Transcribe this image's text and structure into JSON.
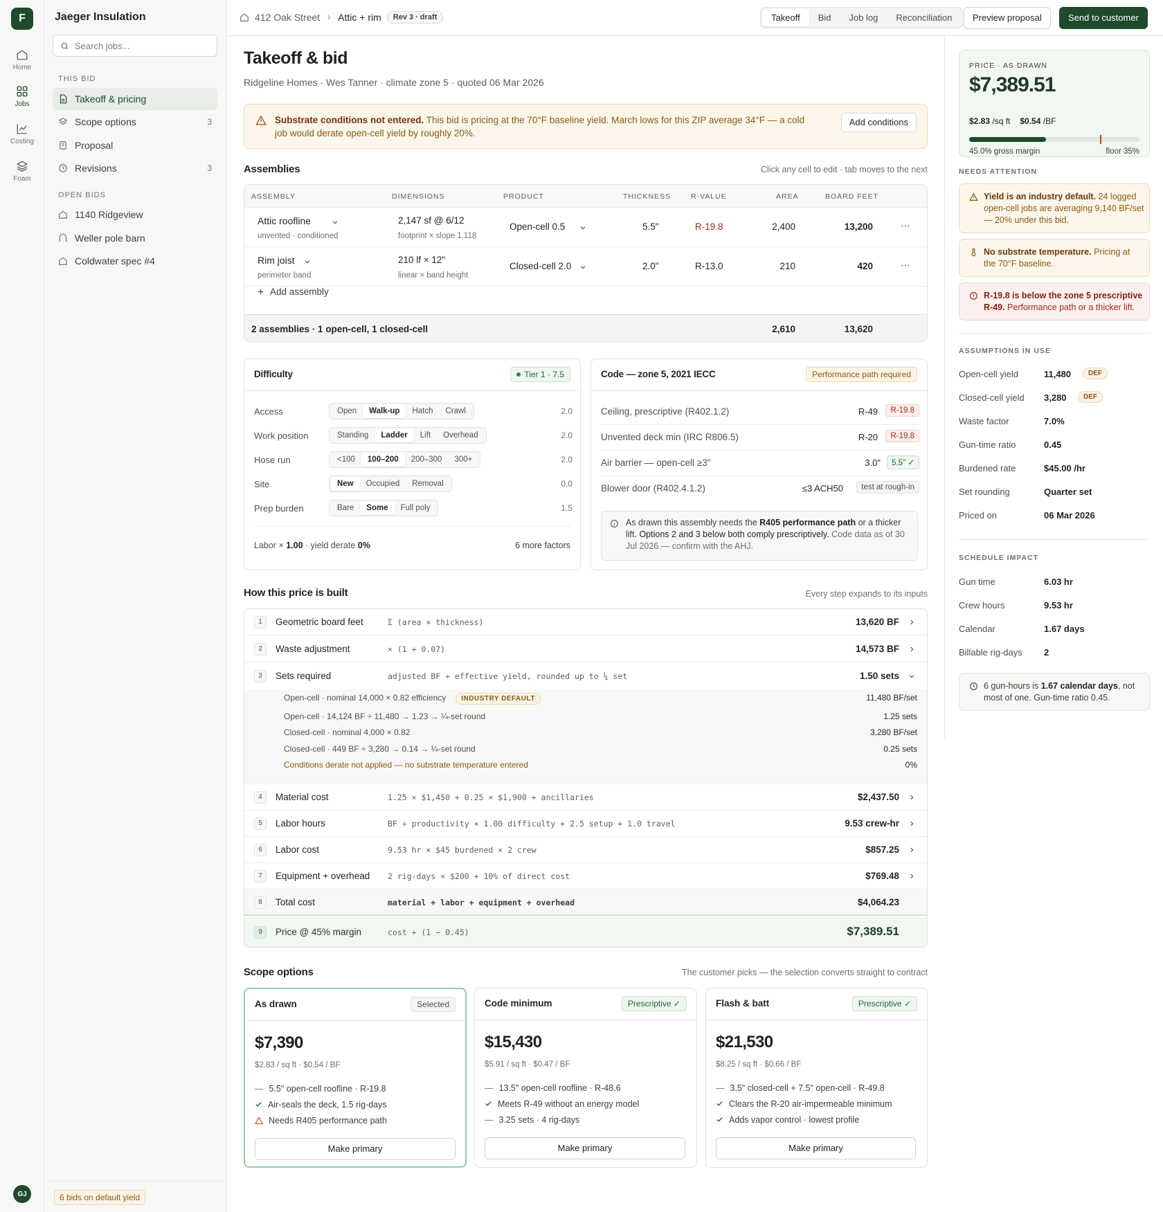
{
  "rail": {
    "logo": "F",
    "items": [
      {
        "label": "Home",
        "icon": "home-icon"
      },
      {
        "label": "Jobs",
        "icon": "jobs-icon"
      },
      {
        "label": "Costing",
        "icon": "chart-icon"
      },
      {
        "label": "Foam",
        "icon": "layers-icon"
      }
    ],
    "user_initials": "GJ"
  },
  "sidebar": {
    "org": "Jaeger Insulation",
    "search_placeholder": "Search jobs...",
    "section_this_bid": "THIS BID",
    "this_bid_items": [
      {
        "label": "Takeoff & pricing",
        "count": ""
      },
      {
        "label": "Scope options",
        "count": "3"
      },
      {
        "label": "Proposal",
        "count": ""
      },
      {
        "label": "Revisions",
        "count": "3"
      }
    ],
    "section_open_bids": "OPEN BIDS",
    "open_bids": [
      "1140 Ridgeview",
      "Weller pole barn",
      "Coldwater spec #4"
    ],
    "footer_chip": "6 bids on default yield"
  },
  "topbar": {
    "breadcrumb": [
      "412 Oak Street",
      "Attic + rim"
    ],
    "rev_badge": "Rev 3 · draft",
    "tabs": [
      "Takeoff",
      "Bid",
      "Job log",
      "Reconciliation"
    ],
    "active_tab": "Takeoff",
    "preview_label": "Preview proposal",
    "send_label": "Send to customer"
  },
  "page": {
    "title": "Takeoff & bid",
    "subtitle": "Ridgeline Homes · Wes Tanner · climate zone 5 · quoted 06 Mar 2026"
  },
  "alert": {
    "bold": "Substrate conditions not entered.",
    "text": " This bid is pricing at the 70°F baseline yield. March lows for this ZIP average 34°F — a cold job would derate open-cell yield by roughly 20%.",
    "button": "Add conditions"
  },
  "assemblies": {
    "title": "Assemblies",
    "hint": "Click any cell to edit · tab moves to the next",
    "columns": [
      "ASSEMBLY",
      "DIMENSIONS",
      "PRODUCT",
      "THICKNESS",
      "R-VALUE",
      "AREA",
      "BOARD FEET"
    ],
    "rows": [
      {
        "name": "Attic roofline",
        "sub": "unvented · conditioned",
        "dims": "2,147 sf @ 6/12",
        "dims_sub": "footprint × slope 1.118",
        "product": "Open-cell 0.5",
        "thickness": "5.5\"",
        "rvalue": "R-19.8",
        "area": "2,400",
        "bf": "13,200"
      },
      {
        "name": "Rim joist",
        "sub": "perimeter band",
        "dims": "210 lf × 12\"",
        "dims_sub": "linear × band height",
        "product": "Closed-cell 2.0",
        "thickness": "2.0\"",
        "rvalue": "R-13.0",
        "area": "210",
        "bf": "420"
      }
    ],
    "add_label": "Add assembly",
    "footer_summary": "2 assemblies · 1 open-cell, 1 closed-cell",
    "footer_area": "2,610",
    "footer_bf": "13,620"
  },
  "difficulty": {
    "title": "Difficulty",
    "tier": "Tier 1 · 7.5",
    "rows": [
      {
        "label": "Access",
        "options": [
          "Open",
          "Walk-up",
          "Hatch",
          "Crawl"
        ],
        "selected": "Walk-up",
        "value": "2.0"
      },
      {
        "label": "Work position",
        "options": [
          "Standing",
          "Ladder",
          "Lift",
          "Overhead"
        ],
        "selected": "Ladder",
        "value": "2.0"
      },
      {
        "label": "Hose run",
        "options": [
          "<100",
          "100–200",
          "200–300",
          "300+"
        ],
        "selected": "100–200",
        "value": "2.0"
      },
      {
        "label": "Site",
        "options": [
          "New",
          "Occupied",
          "Removal"
        ],
        "selected": "New",
        "value": "0.0"
      },
      {
        "label": "Prep burden",
        "options": [
          "Bare",
          "Some",
          "Full poly"
        ],
        "selected": "Some",
        "value": "1.5"
      }
    ],
    "labor_prefix": "Labor × ",
    "labor_value": "1.00",
    "yield_prefix": " · yield derate ",
    "yield_value": "0%",
    "more_factors": "6 more factors"
  },
  "code": {
    "title": "Code — zone 5, 2021 IECC",
    "badge": "Performance path required",
    "rows": [
      {
        "label": "Ceiling, prescriptive (R402.1.2)",
        "req": "R-49",
        "tag": "R-19.8",
        "tag_type": "red"
      },
      {
        "label": "Unvented deck min (IRC R806.5)",
        "req": "R-20",
        "tag": "R-19.8",
        "tag_type": "red"
      },
      {
        "label": "Air barrier — open-cell ≥3\"",
        "req": "3.0\"",
        "tag": "5.5\" ✓",
        "tag_type": "green"
      },
      {
        "label": "Blower door (R402.4.1.2)",
        "req": "≤3 ACH50",
        "tag": "test at rough-in",
        "tag_type": "gray"
      }
    ],
    "note_pre": "As drawn this assembly needs the ",
    "note_bold": "R405 performance path",
    "note_mid": " or a thicker lift. ",
    "note_dark": "Options 2 and 3 below both comply prescriptively.",
    "note_post": " Code data as of 30 Jul 2026 — confirm with the AHJ."
  },
  "price_build": {
    "title": "How this price is built",
    "hint": "Every step expands to its inputs",
    "steps": [
      {
        "n": "1",
        "name": "Geometric board feet",
        "formula": "Σ (area × thickness)",
        "value": "13,620 BF"
      },
      {
        "n": "2",
        "name": "Waste adjustment",
        "formula": "× (1 + 0.07)",
        "value": "14,573 BF"
      },
      {
        "n": "3",
        "name": "Sets required",
        "formula": "adjusted BF ÷ effective yield, rounded up to ¼ set",
        "value": "1.50 sets"
      },
      {
        "n": "4",
        "name": "Material cost",
        "formula": "1.25 × $1,450 + 0.25 × $1,900 + ancillaries",
        "value": "$2,437.50"
      },
      {
        "n": "5",
        "name": "Labor hours",
        "formula": "BF ÷ productivity × 1.00 difficulty + 2.5 setup + 1.0 travel",
        "value": "9.53 crew-hr"
      },
      {
        "n": "6",
        "name": "Labor cost",
        "formula": "9.53 hr × $45 burdened × 2 crew",
        "value": "$857.25"
      },
      {
        "n": "7",
        "name": "Equipment + overhead",
        "formula": "2 rig-days × $200 + 10% of direct cost",
        "value": "$769.48"
      },
      {
        "n": "8",
        "name": "Total cost",
        "formula": "material + labor + equipment + overhead",
        "value": "$4,064.23"
      },
      {
        "n": "9",
        "name": "Price @ 45% margin",
        "formula": "cost ÷ (1 − 0.45)",
        "value": "$7,389.51"
      }
    ],
    "sub_rows": [
      {
        "label": "Open-cell · nominal 14,000 × 0.82 efficiency",
        "badge": "INDUSTRY DEFAULT",
        "value": "11,480 BF/set"
      },
      {
        "label": "Open-cell · 14,124 BF ÷ 11,480 → 1.23 → ¼-set round",
        "value": "1.25 sets"
      },
      {
        "label": "Closed-cell · nominal 4,000 × 0.82",
        "value": "3,280 BF/set"
      },
      {
        "label": "Closed-cell · 449 BF ÷ 3,280 → 0.14 → ¼-set round",
        "value": "0.25 sets"
      },
      {
        "label": "Conditions derate not applied — no substrate temperature entered",
        "value": "0%"
      }
    ]
  },
  "scope": {
    "title": "Scope options",
    "hint": "The customer picks — the selection converts straight to contract",
    "options": [
      {
        "name": "As drawn",
        "badge": "Selected",
        "price": "$7,390",
        "unit": "$2.83 / sq ft · $0.54 / BF",
        "bullets": [
          {
            "icon": "dash-icon",
            "text": "5.5\" open-cell roofline · R-19.8"
          },
          {
            "icon": "check-icon",
            "text": "Air-seals the deck, 1.5 rig-days"
          },
          {
            "icon": "warning-icon",
            "text": "Needs R405 performance path"
          }
        ],
        "button": "Make primary"
      },
      {
        "name": "Code minimum",
        "badge": "Prescriptive ✓",
        "price": "$15,430",
        "unit": "$5.91 / sq ft · $0.47 / BF",
        "bullets": [
          {
            "icon": "dash-icon",
            "text": "13.5\" open-cell roofline · R-48.6"
          },
          {
            "icon": "check-icon",
            "text": "Meets R-49 without an energy model"
          },
          {
            "icon": "dash-icon",
            "text": "3.25 sets · 4 rig-days"
          }
        ],
        "button": "Make primary"
      },
      {
        "name": "Flash & batt",
        "badge": "Prescriptive ✓",
        "price": "$21,530",
        "unit": "$8.25 / sq ft · $0.66 / BF",
        "bullets": [
          {
            "icon": "dash-icon",
            "text": "3.5\" closed-cell + 7.5\" open-cell · R-49.8"
          },
          {
            "icon": "check-icon",
            "text": "Clears the R-20 air-impermeable minimum"
          },
          {
            "icon": "check-icon",
            "text": "Adds vapor control · lowest profile"
          }
        ],
        "button": "Make primary"
      }
    ]
  },
  "right_panel": {
    "price_label": "PRICE · AS DRAWN",
    "price": "$7,389.51",
    "per_sqft": "$2.83",
    "per_sqft_unit": " /sq ft",
    "per_bf": "$0.54",
    "per_bf_unit": " /BF",
    "margin_fraction": 0.45,
    "floor_fraction": 0.35,
    "gross_margin": "45.0% gross margin",
    "floor": "floor 35%",
    "needs_attention_title": "NEEDS ATTENTION",
    "attention": [
      {
        "type": "amber",
        "icon": "warning-icon",
        "bold": "Yield is an industry default.",
        "text": " 24 logged open-cell jobs are averaging 9,140 BF/set — 20% under this bid."
      },
      {
        "type": "amber",
        "icon": "thermometer-icon",
        "bold": "No substrate temperature.",
        "text": " Pricing at the 70°F baseline."
      },
      {
        "type": "red",
        "icon": "alert-circle-icon",
        "bold": "R-19.8 is below the zone 5 prescriptive R-49.",
        "text": " Performance path or a thicker lift."
      }
    ],
    "assumptions_title": "ASSUMPTIONS IN USE",
    "assumptions": [
      {
        "label": "Open-cell yield",
        "value": "11,480",
        "def": "DEF"
      },
      {
        "label": "Closed-cell yield",
        "value": "3,280",
        "def": "DEF"
      },
      {
        "label": "Waste factor",
        "value": "7.0%",
        "def": ""
      },
      {
        "label": "Gun-time ratio",
        "value": "0.45",
        "def": ""
      },
      {
        "label": "Burdened rate",
        "value": "$45.00 /hr",
        "def": ""
      },
      {
        "label": "Set rounding",
        "value": "Quarter set",
        "def": ""
      },
      {
        "label": "Priced on",
        "value": "06 Mar 2026",
        "def": ""
      }
    ],
    "schedule_title": "SCHEDULE IMPACT",
    "schedule": [
      {
        "label": "Gun time",
        "value": "6.03 hr"
      },
      {
        "label": "Crew hours",
        "value": "9.53 hr"
      },
      {
        "label": "Calendar",
        "value": "1.67 days"
      },
      {
        "label": "Billable rig-days",
        "value": "2"
      }
    ],
    "note_pre": "6 gun-hours is ",
    "note_bold": "1.67 calendar days",
    "note_post": ", not most of one. Gun-time ratio 0.45."
  },
  "colors": {
    "brand": "#1f4a2c",
    "amber": "#8a5a12",
    "red": "#a32a1a",
    "green": "#1f6a38"
  }
}
